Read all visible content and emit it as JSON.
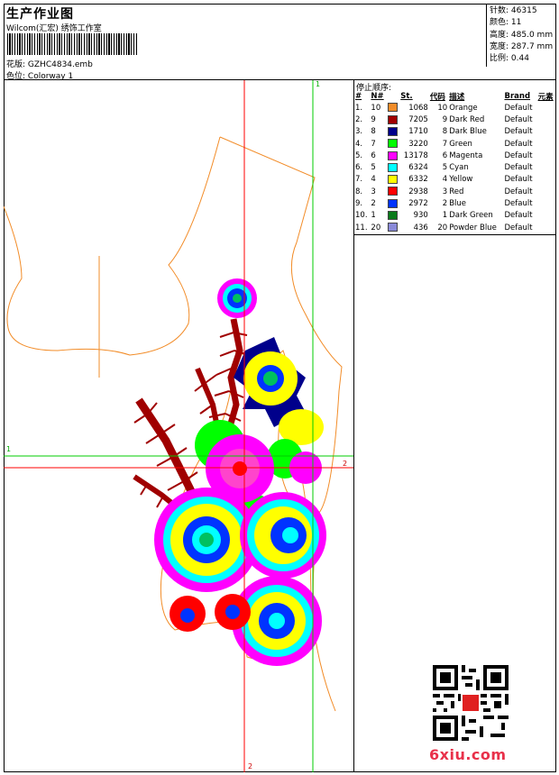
{
  "header": {
    "title": "生产作业图",
    "subtitle": "Wilcom(汇宏) 绣饰工作室",
    "design_label": "花版:",
    "design_value": "GZHC4834.emb",
    "colorway_label": "色位:",
    "colorway_value": "Colorway 1"
  },
  "stats": [
    {
      "label": "针数:",
      "value": "46315"
    },
    {
      "label": "颜色:",
      "value": "11"
    },
    {
      "label": "高度:",
      "value": "485.0 mm"
    },
    {
      "label": "宽度:",
      "value": "287.7 mm"
    },
    {
      "label": "比例:",
      "value": "0.44"
    }
  ],
  "stop_sequence": {
    "title": "停止顺序:",
    "columns": [
      "#",
      "N#",
      "St.",
      "代码",
      "描述",
      "Brand",
      "元素"
    ],
    "rows": [
      {
        "idx": "1.",
        "n": "10",
        "color": "#f28c28",
        "st": "1068",
        "code": "10",
        "desc": "Orange",
        "brand": "Default"
      },
      {
        "idx": "2.",
        "n": "9",
        "color": "#a00000",
        "st": "7205",
        "code": "9",
        "desc": "Dark Red",
        "brand": "Default"
      },
      {
        "idx": "3.",
        "n": "8",
        "color": "#00008b",
        "st": "1710",
        "code": "8",
        "desc": "Dark Blue",
        "brand": "Default"
      },
      {
        "idx": "4.",
        "n": "7",
        "color": "#00ff00",
        "st": "3220",
        "code": "7",
        "desc": "Green",
        "brand": "Default"
      },
      {
        "idx": "5.",
        "n": "6",
        "color": "#ff00ff",
        "st": "13178",
        "code": "6",
        "desc": "Magenta",
        "brand": "Default"
      },
      {
        "idx": "6.",
        "n": "5",
        "color": "#00ffff",
        "st": "6324",
        "code": "5",
        "desc": "Cyan",
        "brand": "Default"
      },
      {
        "idx": "7.",
        "n": "4",
        "color": "#ffff00",
        "st": "6332",
        "code": "4",
        "desc": "Yellow",
        "brand": "Default"
      },
      {
        "idx": "8.",
        "n": "3",
        "color": "#ff0000",
        "st": "2938",
        "code": "3",
        "desc": "Red",
        "brand": "Default"
      },
      {
        "idx": "9.",
        "n": "2",
        "color": "#0033ff",
        "st": "2972",
        "code": "2",
        "desc": "Blue",
        "brand": "Default"
      },
      {
        "idx": "10.",
        "n": "1",
        "color": "#0a7a1a",
        "st": "930",
        "code": "1",
        "desc": "Dark Green",
        "brand": "Default"
      },
      {
        "idx": "11.",
        "n": "20",
        "color": "#8a8ad8",
        "st": "436",
        "code": "20",
        "desc": "Powder Blue",
        "brand": "Default"
      }
    ]
  },
  "guides": {
    "h1": "1",
    "h2": "2",
    "v1": "1",
    "v2": "2"
  },
  "watermark": "6xiu.com"
}
